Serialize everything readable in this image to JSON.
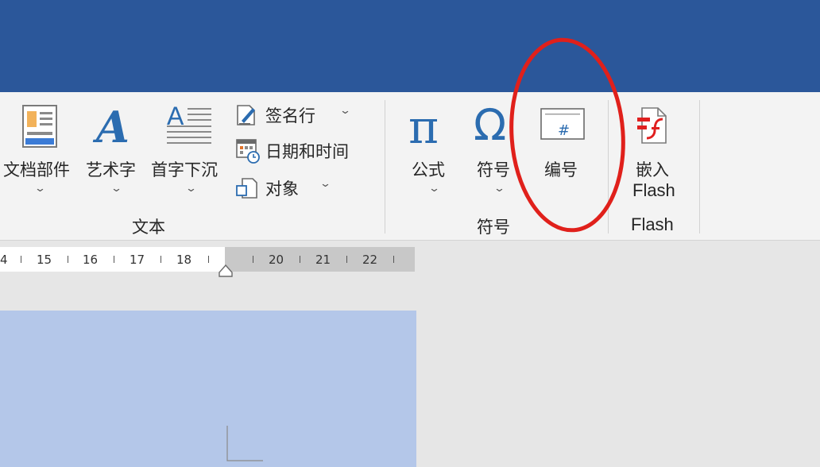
{
  "ribbon": {
    "text_group": {
      "label": "文本",
      "quick_parts": {
        "label": "文档部件",
        "icon": "quick-parts-icon"
      },
      "wordart": {
        "label": "艺术字",
        "glyph": "A",
        "icon": "wordart-icon"
      },
      "drop_cap": {
        "label": "首字下沉",
        "glyph": "A",
        "icon": "drop-cap-icon"
      },
      "signature_line": {
        "label": "签名行",
        "icon": "signature-line-icon"
      },
      "date_time": {
        "label": "日期和时间",
        "icon": "calendar-clock-icon"
      },
      "object": {
        "label": "对象",
        "icon": "object-icon"
      }
    },
    "symbols_group": {
      "label": "符号",
      "equation": {
        "label": "公式",
        "glyph": "π",
        "icon": "pi-icon"
      },
      "symbol": {
        "label": "符号",
        "glyph": "Ω",
        "icon": "omega-icon"
      },
      "number": {
        "label": "编号",
        "glyph": "#",
        "icon": "number-icon"
      }
    },
    "flash_group": {
      "label": "Flash",
      "embed_flash": {
        "label_line1": "嵌入",
        "label_line2": "Flash",
        "icon": "flash-icon"
      }
    }
  },
  "ruler": {
    "numbers": [
      "4",
      "15",
      "16",
      "17",
      "18",
      "20",
      "21",
      "22"
    ]
  },
  "colors": {
    "title_bar": "#2b579a",
    "ribbon_bg": "#f3f3f3",
    "accent_blue": "#2b6cb0",
    "highlight_ring": "#e0201b",
    "page_selection": "#b4c7e9"
  }
}
